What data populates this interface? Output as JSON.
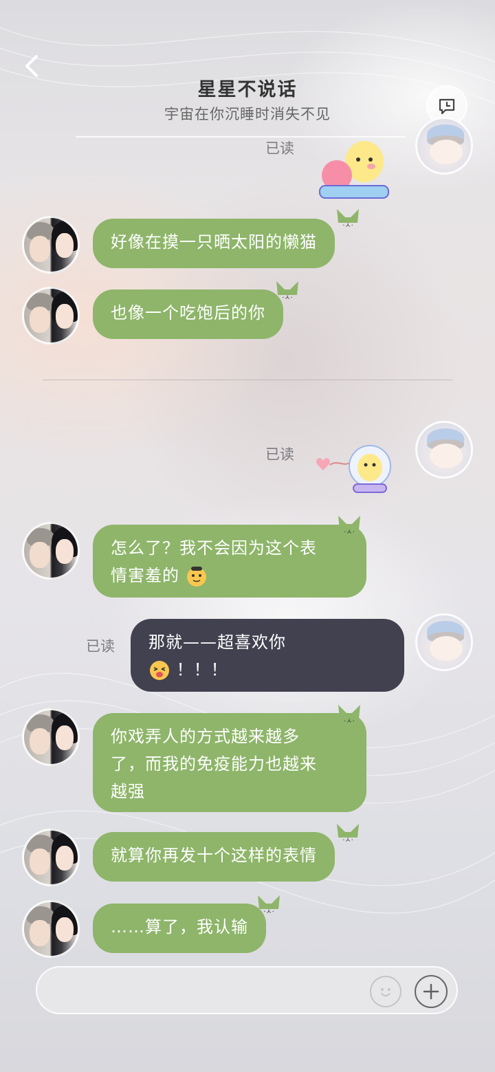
{
  "header": {
    "title": "星星不说话",
    "subtitle": "宇宙在你沉睡时消失不见"
  },
  "colors": {
    "bubble_green": "#8eb56a",
    "bubble_dark": "#424150",
    "text_white": "#ffffff"
  },
  "icons": {
    "back": "chevron-left-icon",
    "profile": "chat-clock-icon",
    "emoji": "smiley-icon",
    "plus": "plus-icon"
  },
  "messages": [
    {
      "id": "m0",
      "side": "right",
      "type": "sticker",
      "read_label": "已读"
    },
    {
      "id": "m1",
      "side": "left",
      "text": "好像在摸一只晒太阳的懒猫"
    },
    {
      "id": "m2",
      "side": "left",
      "text": "也像一个吃饱后的你"
    },
    {
      "id": "m3",
      "side": "right",
      "type": "sticker",
      "read_label": "已读"
    },
    {
      "id": "m4",
      "side": "left",
      "text_line1": "怎么了？我不会因为这个表",
      "text_line2": "情害羞的"
    },
    {
      "id": "m5",
      "side": "right",
      "read_label": "已读",
      "text_line1": "那就——超喜欢你",
      "text_line2": "！！！"
    },
    {
      "id": "m6",
      "side": "left",
      "text_line1": "你戏弄人的方式越来越多",
      "text_line2": "了，而我的免疫能力也越来",
      "text_line3": "越强"
    },
    {
      "id": "m7",
      "side": "left",
      "text": "就算你再发十个这样的表情"
    },
    {
      "id": "m8",
      "side": "left",
      "text": "……算了，我认输"
    }
  ]
}
